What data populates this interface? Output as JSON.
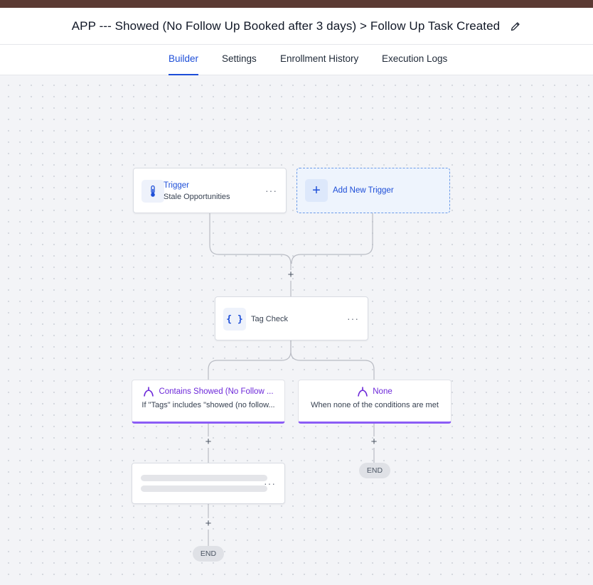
{
  "header": {
    "title": "APP --- Showed (No Follow Up Booked after 3 days) > Follow Up Task Created",
    "edit_icon": "pencil-icon"
  },
  "tabs": [
    {
      "label": "Builder",
      "active": true
    },
    {
      "label": "Settings",
      "active": false
    },
    {
      "label": "Enrollment History",
      "active": false
    },
    {
      "label": "Execution Logs",
      "active": false
    }
  ],
  "workflow": {
    "trigger": {
      "title": "Trigger",
      "subtitle": "Stale Opportunities",
      "icon": "thermometer-icon",
      "menu": "···"
    },
    "add_trigger": {
      "label": "Add New Trigger",
      "icon": "plus-icon",
      "symbol": "+"
    },
    "condition": {
      "title": "Tag Check",
      "icon": "braces-icon",
      "symbol": "{ }",
      "menu": "···"
    },
    "branches": [
      {
        "title": "Contains Showed (No Follow ...",
        "subtitle": "If \"Tags\" includes \"showed (no follow...",
        "icon": "branch-icon"
      },
      {
        "title": "None",
        "subtitle": "When none of the conditions are met",
        "icon": "branch-icon"
      }
    ],
    "placeholder_action": {
      "menu": "···"
    },
    "add_step_symbol": "+",
    "end_label": "END"
  },
  "colors": {
    "accent": "#1d4ed8",
    "branch_accent": "#8b5cf6",
    "top_bar": "#5b3a33",
    "connector": "#b9bcc4"
  }
}
